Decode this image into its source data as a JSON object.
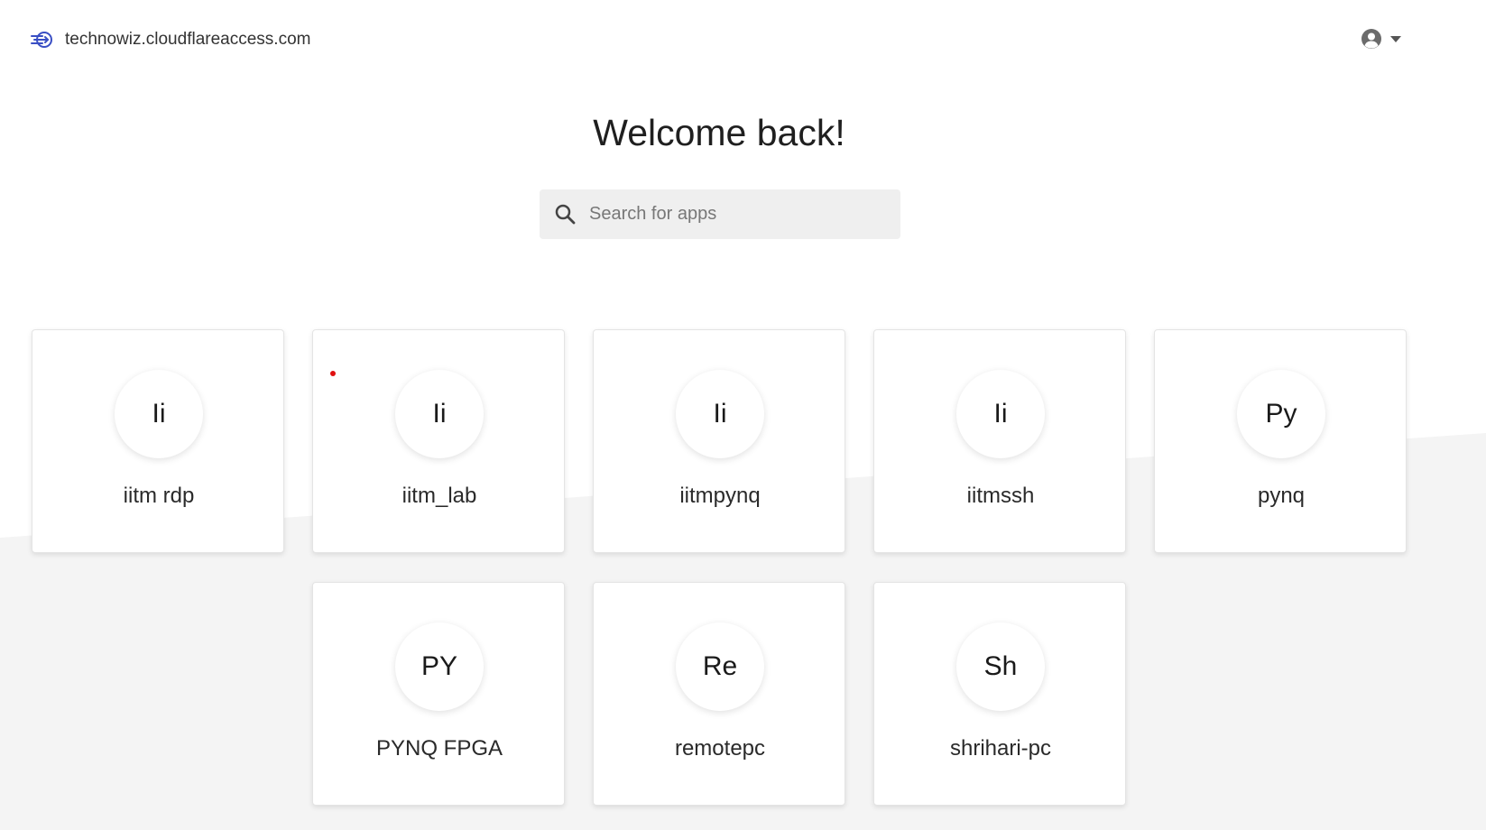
{
  "header": {
    "domain": "technowiz.cloudflareaccess.com",
    "brand_icon": "access-arrow-icon",
    "user_icon": "user-circle-icon",
    "menu_icon": "caret-down-icon"
  },
  "main": {
    "welcome": "Welcome back!",
    "search": {
      "placeholder": "Search for apps",
      "value": "",
      "icon": "search-icon"
    }
  },
  "apps": [
    {
      "initials": "Ii",
      "name": "iitm rdp"
    },
    {
      "initials": "Ii",
      "name": "iitm_lab"
    },
    {
      "initials": "Ii",
      "name": "iitmpynq"
    },
    {
      "initials": "Ii",
      "name": "iitmssh"
    },
    {
      "initials": "Py",
      "name": "pynq"
    },
    {
      "initials": "PY",
      "name": "PYNQ FPGA"
    },
    {
      "initials": "Re",
      "name": "remotepc"
    },
    {
      "initials": "Sh",
      "name": "shrihari-pc"
    }
  ],
  "colors": {
    "accent": "#3a4fc4",
    "background_band": "#f4f4f4"
  }
}
